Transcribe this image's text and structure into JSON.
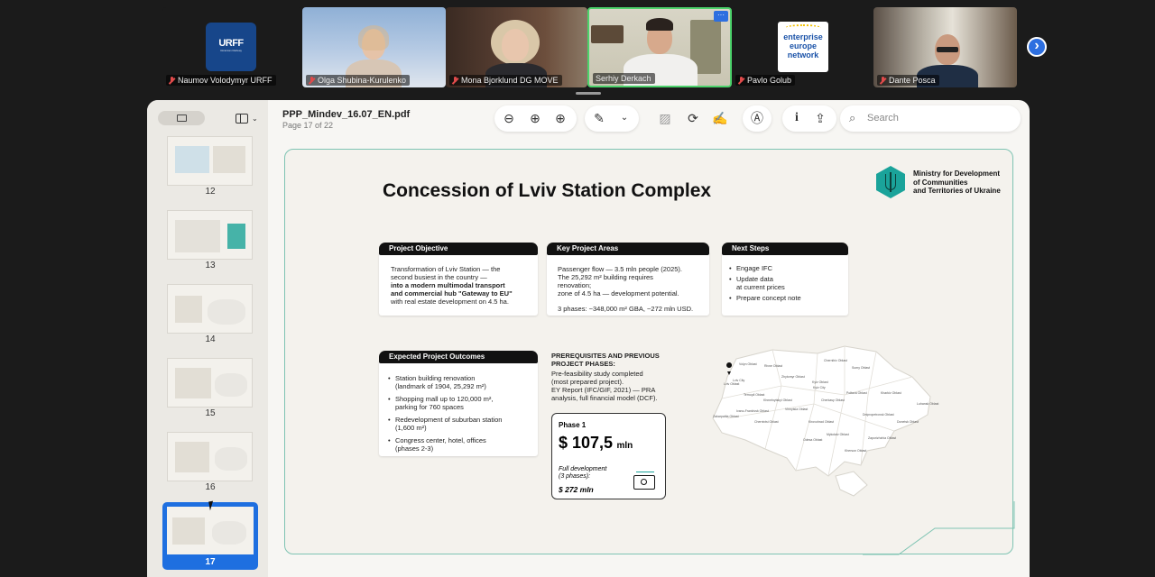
{
  "participants": [
    {
      "name": "Naumov Volodymyr URFF",
      "logo": "URFF",
      "logo_sub": "Ukrainian Railway"
    },
    {
      "name": "Olga Shubina-Kurulenko"
    },
    {
      "name": "Mona Bjorklund DG MOVE"
    },
    {
      "name": "Serhiy Derkach",
      "menu": "···"
    },
    {
      "name": "Pavlo Golub",
      "logo_lines": [
        "enterprise",
        "europe",
        "network"
      ]
    },
    {
      "name": "Dante Posca"
    }
  ],
  "next_arrow": "›",
  "viewer": {
    "filename": "PPP_Mindev_16.07_EN.pdf",
    "page_info": "Page 17 of 22",
    "search_placeholder": "Search",
    "thumbnails": [
      "12",
      "13",
      "14",
      "15",
      "16",
      "17"
    ],
    "selected_page": "17"
  },
  "slide": {
    "title": "Concession of Lviv Station Complex",
    "ministry": [
      "Ministry for Development",
      "of Communities",
      "and Territories of Ukraine"
    ],
    "objective": {
      "header": "Project Objective",
      "lines": [
        "Transformation of Lviv Station — the",
        "second busiest in the country —",
        "into a modern multimodal transport",
        "and commercial hub \"Gateway to EU\"",
        "with real estate development on 4.5 ha."
      ]
    },
    "key_areas": {
      "header": "Key Project Areas",
      "lines": [
        "Passenger flow — 3.5 mln people (2025).",
        "The 25,292 m² building requires",
        "renovation;",
        "zone of 4.5 ha — development potential."
      ],
      "phases": "3 phases: ~348,000 m² GBA, ~272 mln USD."
    },
    "next_steps": {
      "header": "Next Steps",
      "items": [
        "Engage IFC",
        "Update data\nat current prices",
        "Prepare concept note"
      ]
    },
    "outcomes": {
      "header": "Expected Project Outcomes",
      "items": [
        "Station building renovation\n(landmark of 1904, 25,292 m²)",
        "Shopping mall up to 120,000 m²,\nparking for 760 spaces",
        "Redevelopment of suburban station\n(1,600 m²)",
        "Congress center, hotel, offices\n(phases 2-3)"
      ]
    },
    "prereq": {
      "header": [
        "PREREQUISITES AND PREVIOUS",
        "PROJECT PHASES:"
      ],
      "lines": [
        "Pre-feasibility study completed",
        "(most prepared project).",
        "EY Report (IFC/GIF, 2021) — PRA",
        "analysis, full financial model (DCF)."
      ]
    },
    "phase": {
      "label": "Phase 1",
      "amount": "$ 107,5",
      "unit": "mln",
      "full_label": [
        "Full development",
        "(3 phases):"
      ],
      "full_amount": "$ 272 mln"
    },
    "map_labels": [
      "Volyn Oblast",
      "Rivne Oblast",
      "Zhytomyr Oblast",
      "Kyiv Oblast",
      "Chernihiv Oblast",
      "Sumy Oblast",
      "Lviv Oblast",
      "Ternopil Oblast",
      "Khmelnytskyi Oblast",
      "Vinnytsia Oblast",
      "Cherkasy Oblast",
      "Poltava Oblast",
      "Kharkiv Oblast",
      "Luhansk Oblast",
      "Ivano-Frankivsk Oblast",
      "Zakarpattia Oblast",
      "Chernivtsi Oblast",
      "Kirovohrad Oblast",
      "Dnipropetrovsk Oblast",
      "Donetsk Oblast",
      "Odesa Oblast",
      "Mykolaiv Oblast",
      "Zaporizhzhia Oblast",
      "Kherson Oblast",
      "Lviv City",
      "Kyiv City"
    ]
  },
  "colors": {
    "accent_teal": "#1aa39a",
    "selected_thumb": "#1e6fe0",
    "speaker_border": "#4cd26b"
  }
}
